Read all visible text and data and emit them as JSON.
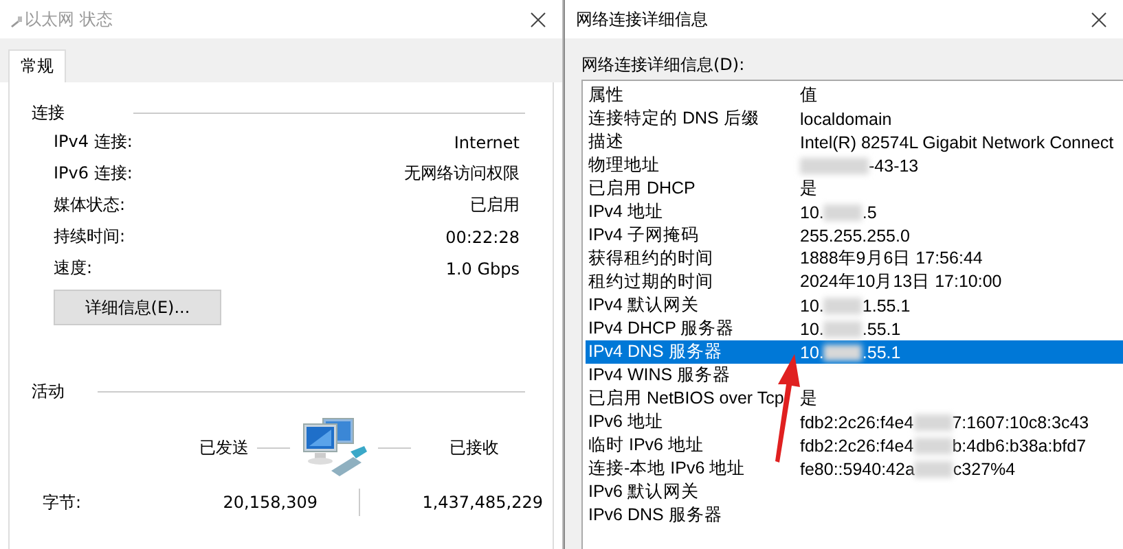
{
  "status_window": {
    "title": "以太网 状态",
    "tabs": [
      {
        "label": "常规",
        "selected": true
      }
    ],
    "connection": {
      "heading": "连接",
      "rows": [
        {
          "label": "IPv4 连接:",
          "value": "Internet"
        },
        {
          "label": "IPv6 连接:",
          "value": "无网络访问权限"
        },
        {
          "label": "媒体状态:",
          "value": "已启用"
        },
        {
          "label": "持续时间:",
          "value": "00:22:28"
        },
        {
          "label": "速度:",
          "value": "1.0 Gbps"
        }
      ]
    },
    "details_button": "详细信息(E)...",
    "activity": {
      "heading": "活动",
      "sent_label": "已发送",
      "received_label": "已接收",
      "bytes_label": "字节:",
      "bytes_sent": "20,158,309",
      "bytes_received": "1,437,485,229"
    }
  },
  "details_window": {
    "title": "网络连接详细信息",
    "list_label": "网络连接详细信息(D):",
    "columns": [
      "属性",
      "值"
    ],
    "rows": [
      {
        "property": "连接特定的 DNS 后缀",
        "value": [
          "localdomain"
        ],
        "selected": false
      },
      {
        "property": "描述",
        "value": [
          "Intel(R) 82574L Gigabit Network Connect"
        ],
        "selected": false
      },
      {
        "property": "物理地址",
        "value": [
          "-43-13"
        ],
        "leading_blur": true,
        "selected": false
      },
      {
        "property": "已启用 DHCP",
        "value": [
          "是"
        ],
        "selected": false
      },
      {
        "property": "IPv4 地址",
        "value": [
          "10.",
          ".5"
        ],
        "selected": false
      },
      {
        "property": "IPv4 子网掩码",
        "value": [
          "255.255.255.0"
        ],
        "selected": false
      },
      {
        "property": "获得租约的时间",
        "value": [
          "1888年9月6日 17:56:44"
        ],
        "selected": false
      },
      {
        "property": "租约过期的时间",
        "value": [
          "2024年10月13日 17:10:00"
        ],
        "selected": false
      },
      {
        "property": "IPv4 默认网关",
        "value": [
          "10.",
          "1.55.1"
        ],
        "selected": false
      },
      {
        "property": "IPv4 DHCP 服务器",
        "value": [
          "10.",
          ".55.1"
        ],
        "selected": false
      },
      {
        "property": "IPv4 DNS 服务器",
        "value": [
          "10.",
          ".55.1"
        ],
        "selected": true
      },
      {
        "property": "IPv4 WINS 服务器",
        "value": [],
        "selected": false
      },
      {
        "property": "已启用 NetBIOS over Tcp",
        "value": [
          "是"
        ],
        "selected": false
      },
      {
        "property": "IPv6 地址",
        "value": [
          "fdb2:2c26:f4e4",
          "7:1607:10c8:3c43"
        ],
        "selected": false
      },
      {
        "property": "临时 IPv6 地址",
        "value": [
          "fdb2:2c26:f4e4",
          "b:4db6:b38a:bfd7"
        ],
        "selected": false
      },
      {
        "property": "连接-本地 IPv6 地址",
        "value": [
          "fe80::5940:42a",
          "c327%4"
        ],
        "selected": false
      },
      {
        "property": "IPv6 默认网关",
        "value": [],
        "selected": false
      },
      {
        "property": "IPv6 DNS 服务器",
        "value": [],
        "selected": false
      }
    ]
  }
}
